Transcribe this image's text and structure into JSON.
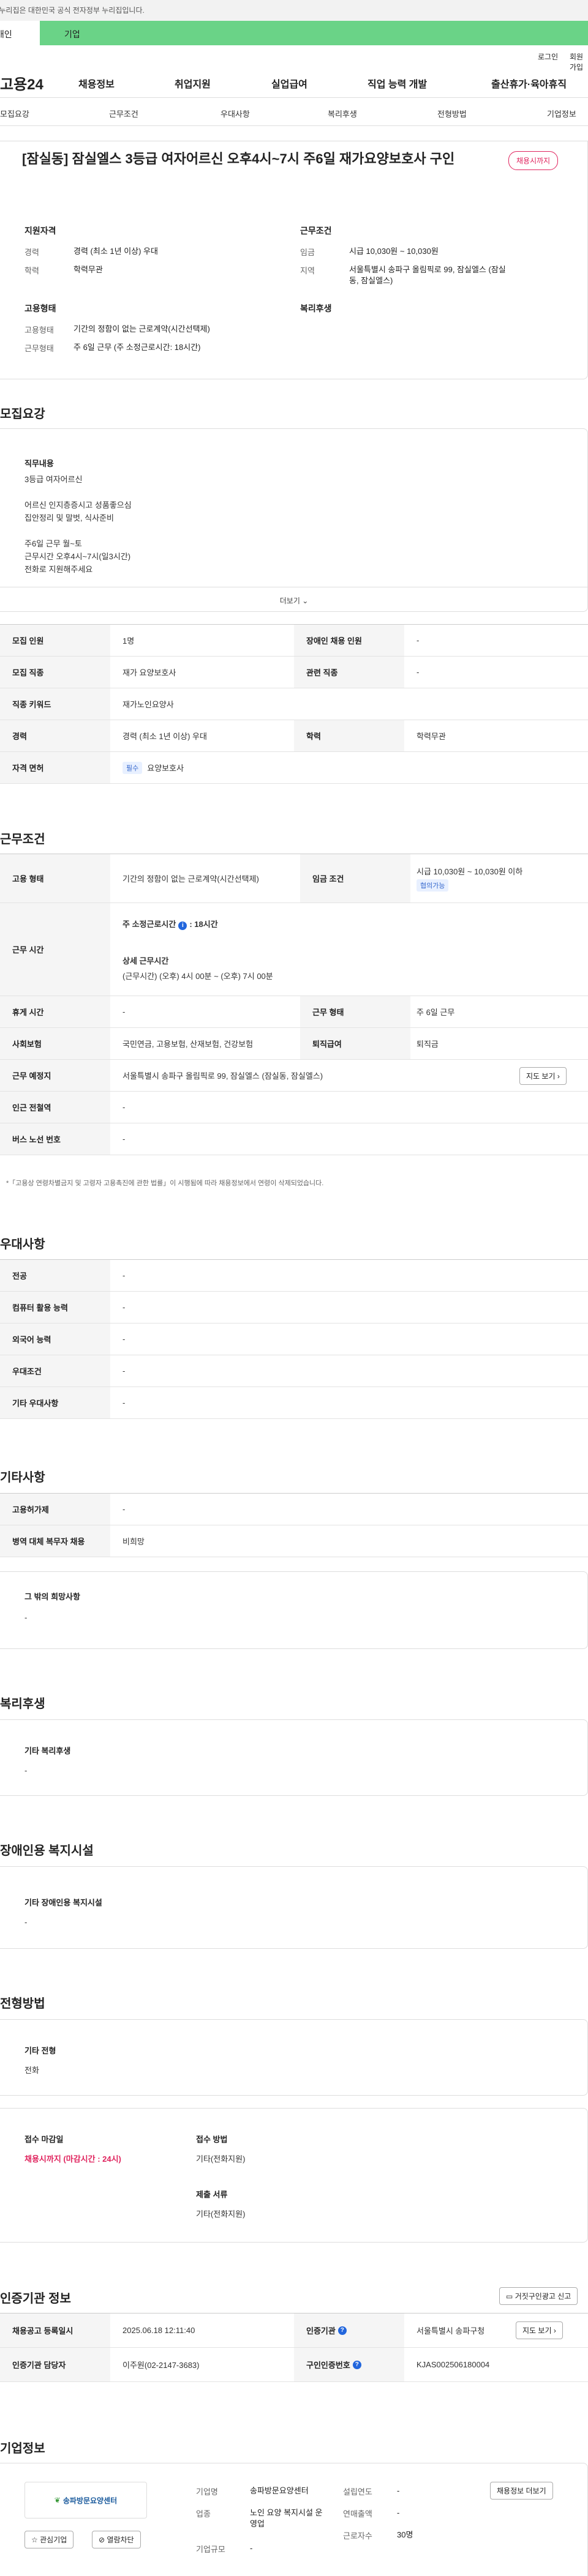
{
  "topbar": {
    "notice": "이 누리집은 대한민국 공식 전자정부 누리집입니다."
  },
  "user_tabs": {
    "individual": "개인",
    "business": "기업"
  },
  "util": {
    "login": "로그인",
    "join": "회원가입"
  },
  "gnb": {
    "logo": "고용24",
    "items": [
      "채용정보",
      "취업지원",
      "실업급여",
      "직업 능력 개발",
      "출산휴가·육아휴직"
    ]
  },
  "anchor": {
    "items": [
      "모집요강",
      "근무조건",
      "우대사항",
      "복리후생",
      "전형방법",
      "기업정보"
    ]
  },
  "hero": {
    "title": "[잠실동] 잠실엘스 3등급 여자어르신 오후4시~7시 주6일 재가요양보호사 구인",
    "status": "채용시까지",
    "qual_title": "지원자격",
    "career_label": "경력",
    "career_value": "경력 (최소 1년 이상) 우대",
    "edu_label": "학력",
    "edu_value": "학력무관",
    "employ_title": "고용형태",
    "emp_type_label": "고용형태",
    "emp_type_value": "기간의 정함이 없는 근로계약(시간선택제)",
    "work_time_label": "근무형태",
    "work_time_value": "주 6일 근무 (주 소정근로시간: 18시간)",
    "cond_title": "근무조건",
    "wage_label": "임금",
    "wage_value": "시급 10,030원 ~ 10,030원",
    "region_label": "지역",
    "region_value": "서울특별시 송파구 올림픽로 99, 잠실엘스 (잠실동, 잠실엘스)",
    "welfare_title": "복리후생"
  },
  "recruit": {
    "section_title": "모집요강",
    "duty_title": "직무내용",
    "duty_text": "3등급 여자어르신\n\n어르신 인지층증시고 성품좋으심\n집안정리 및 말벗, 식사준비\n\n주6일 근무 월~토\n근무시간 오후4시~7시(일3시간)\n전화로 지원해주세요",
    "more": "더보기",
    "rows": [
      {
        "l1": "모집 인원",
        "v1": "1명",
        "l2": "장애인 채용 인원",
        "v2": "-"
      },
      {
        "l1": "모집 직종",
        "v1": "재가 요양보호사",
        "l2": "관련 직종",
        "v2": "-"
      },
      {
        "l1": "직종 키워드",
        "v1": "재가노인요양사"
      },
      {
        "l1": "경력",
        "v1": "경력 (최소 1년 이상) 우대",
        "l2": "학력",
        "v2": "학력무관"
      },
      {
        "l1": "자격 면허",
        "chip": "필수",
        "v1": "요양보호사"
      }
    ]
  },
  "conditions": {
    "section_title": "근무조건",
    "emp_type_label": "고용 형태",
    "emp_type_value": "기간의 정함이 없는 근로계약(시간선택제)",
    "wage_label": "임금 조건",
    "wage_value": "시급 10,030원 ~ 10,030원 이하",
    "wage_chip": "협의가능",
    "hours_label": "근무 시간",
    "hours_week": "주 소정근로시간",
    "hours_week_value": ": 18시간",
    "hours_detail_title": "상세 근무시간",
    "hours_detail_value": "(근무시간) (오후) 4시 00분 ~ (오후) 7시 00분",
    "rest_label": "휴게 시간",
    "rest_value": "-",
    "form_label": "근무 형태",
    "form_value": "주 6일 근무",
    "insurance_label": "사회보험",
    "insurance_value": "국민연금, 고용보험, 산재보험, 건강보험",
    "retire_label": "퇴직급여",
    "retire_value": "퇴직금",
    "place_label": "근무 예정지",
    "place_value": "서울특별시 송파구 올림픽로 99, 잠실엘스 (잠실동, 잠실엘스)",
    "map_btn": "지도 보기",
    "station_label": "인근 전철역",
    "station_value": "-",
    "bus_label": "버스 노선 번호",
    "bus_value": "-",
    "note": "*「고용상 연령차별금지 및 고령자 고용촉진에 관한 법률」이 시행됨에 따라 채용정보에서 연령이 삭제되었습니다."
  },
  "preference": {
    "section_title": "우대사항",
    "rows": [
      {
        "l": "전공",
        "v": "-"
      },
      {
        "l": "컴퓨터 활용 능력",
        "v": "-"
      },
      {
        "l": "외국어 능력",
        "v": "-"
      },
      {
        "l": "우대조건",
        "v": "-"
      },
      {
        "l": "기타 우대사항",
        "v": "-"
      }
    ]
  },
  "etc": {
    "section_title": "기타사항",
    "rows": [
      {
        "l": "고용허가제",
        "v": "-"
      },
      {
        "l": "병역 대체 복무자 채용",
        "v": "비희망"
      }
    ],
    "other_title": "그 밖의 희망사항",
    "other_value": "-"
  },
  "welfare": {
    "section_title": "복리후생",
    "box_title": "기타 복리후생",
    "box_value": "-"
  },
  "disability": {
    "section_title": "장애인용 복지시설",
    "box_title": "기타 장애인용 복지시설",
    "box_value": "-"
  },
  "selection": {
    "section_title": "전형방법",
    "other_title": "기타 전형",
    "other_value": "전화",
    "deadline_title": "접수 마감일",
    "deadline_value": "채용시까지 (마감시간 : 24시)",
    "method_title": "접수 방법",
    "method_value": "기타(전화지원)",
    "docs_title": "제출 서류",
    "docs_value": "기타(전화지원)"
  },
  "agency": {
    "section_title": "인증기관 정보",
    "report_btn": "거짓구인광고 신고",
    "reg_label": "채용공고 등록일시",
    "reg_value": "2025.06.18 12:11:40",
    "org_label": "인증기관",
    "org_value": "서울특별시 송파구청",
    "map_btn": "지도 보기",
    "manager_label": "인증기관 담당자",
    "manager_value": "이주원(02-2147-3683)",
    "cert_label": "구인인증번호",
    "cert_value": "KJAS002506180004"
  },
  "company": {
    "section_title": "기업정보",
    "logo_text": "송파방문요양센터",
    "fav_btn": "관심기업",
    "follow_btn": "열람차단",
    "name_label": "기업명",
    "name_value": "송파방문요양센터",
    "biz_label": "업종",
    "biz_value": "노인 요양 복지시설 운영업",
    "size_label": "기업규모",
    "size_value": "-",
    "year_label": "설립연도",
    "year_value": "-",
    "sales_label": "연매출액",
    "sales_value": "-",
    "emp_label": "근로자수",
    "emp_value": "30명",
    "jobs_btn": "채용정보 더보기"
  },
  "colors": {
    "brand_green": "#6ad387",
    "alert_red": "#e0245e",
    "info_blue": "#2266dd"
  }
}
